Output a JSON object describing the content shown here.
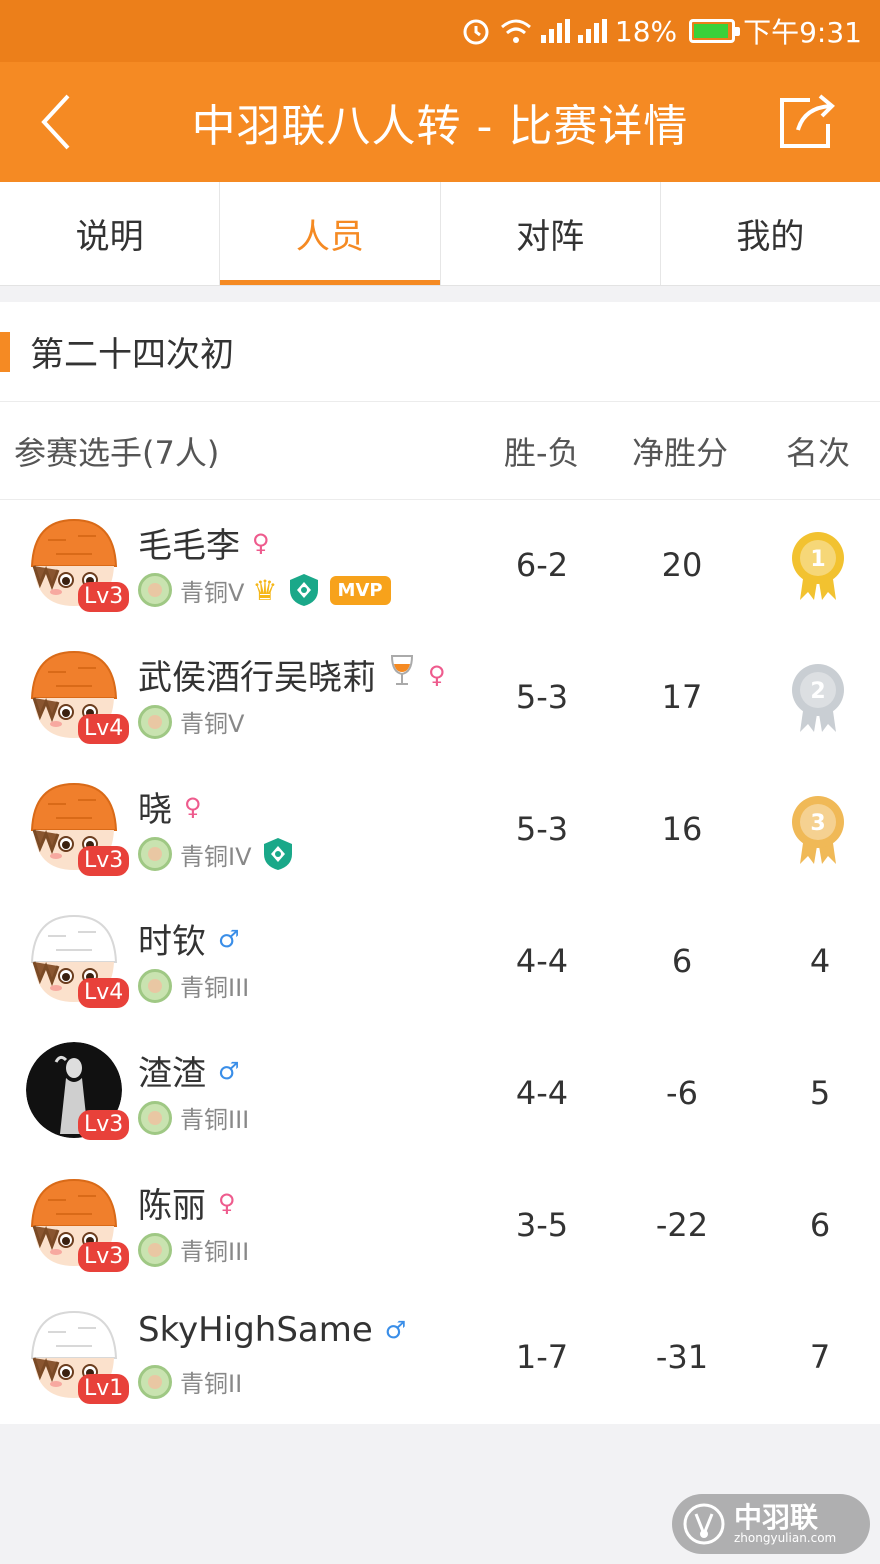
{
  "status_bar": {
    "battery": "18%",
    "time": "下午9:31",
    "battery_color": "#3ad13a",
    "battery_level": 0.18
  },
  "header": {
    "title": "中羽联八人转 - 比赛详情",
    "background": "#f58a23"
  },
  "tabs": [
    {
      "label": "说明",
      "active": false
    },
    {
      "label": "人员",
      "active": true
    },
    {
      "label": "对阵",
      "active": false
    },
    {
      "label": "我的",
      "active": false
    }
  ],
  "section": {
    "title": "第二十四次初"
  },
  "columns": {
    "players": "参赛选手(7人)",
    "wl": "胜-负",
    "net": "净胜分",
    "rank": "名次"
  },
  "players": [
    {
      "name": "毛毛李",
      "sex": "♀",
      "level": "Lv3",
      "tier": "青铜V",
      "badges": [
        "crown-icon",
        "shield-icon",
        "MVP"
      ],
      "wl": "6-2",
      "net": "20",
      "rank": "",
      "medal": "1",
      "medal_color": "#f2c230",
      "avatar": "orange-hat"
    },
    {
      "name": "武侯酒行吴晓莉",
      "sex": "♀",
      "level": "Lv4",
      "tier": "青铜V",
      "badges": [
        "wine-glass-icon"
      ],
      "wl": "5-3",
      "net": "17",
      "rank": "",
      "medal": "2",
      "medal_color": "#c9ced3",
      "avatar": "orange-hat"
    },
    {
      "name": "晓",
      "sex": "♀",
      "level": "Lv3",
      "tier": "青铜IV",
      "badges": [
        "shield-icon"
      ],
      "wl": "5-3",
      "net": "16",
      "rank": "",
      "medal": "3",
      "medal_color": "#f0b957",
      "avatar": "orange-hat"
    },
    {
      "name": "时钦",
      "sex": "♂",
      "level": "Lv4",
      "tier": "青铜III",
      "badges": [],
      "wl": "4-4",
      "net": "6",
      "rank": "4",
      "medal": "",
      "medal_color": "",
      "avatar": "white-hat"
    },
    {
      "name": "渣渣",
      "sex": "♂",
      "level": "Lv3",
      "tier": "青铜III",
      "badges": [],
      "wl": "4-4",
      "net": "-6",
      "rank": "5",
      "medal": "",
      "medal_color": "",
      "avatar": "dark-photo"
    },
    {
      "name": "陈丽",
      "sex": "♀",
      "level": "Lv3",
      "tier": "青铜III",
      "badges": [],
      "wl": "3-5",
      "net": "-22",
      "rank": "6",
      "medal": "",
      "medal_color": "",
      "avatar": "orange-hat"
    },
    {
      "name": "SkyHighSame",
      "sex": "♂",
      "level": "Lv1",
      "tier": "青铜II",
      "badges": [],
      "wl": "1-7",
      "net": "-31",
      "rank": "7",
      "medal": "",
      "medal_color": "",
      "avatar": "white-hat"
    }
  ],
  "watermark": {
    "name": "中羽联",
    "url": "zhongyulian.com"
  }
}
